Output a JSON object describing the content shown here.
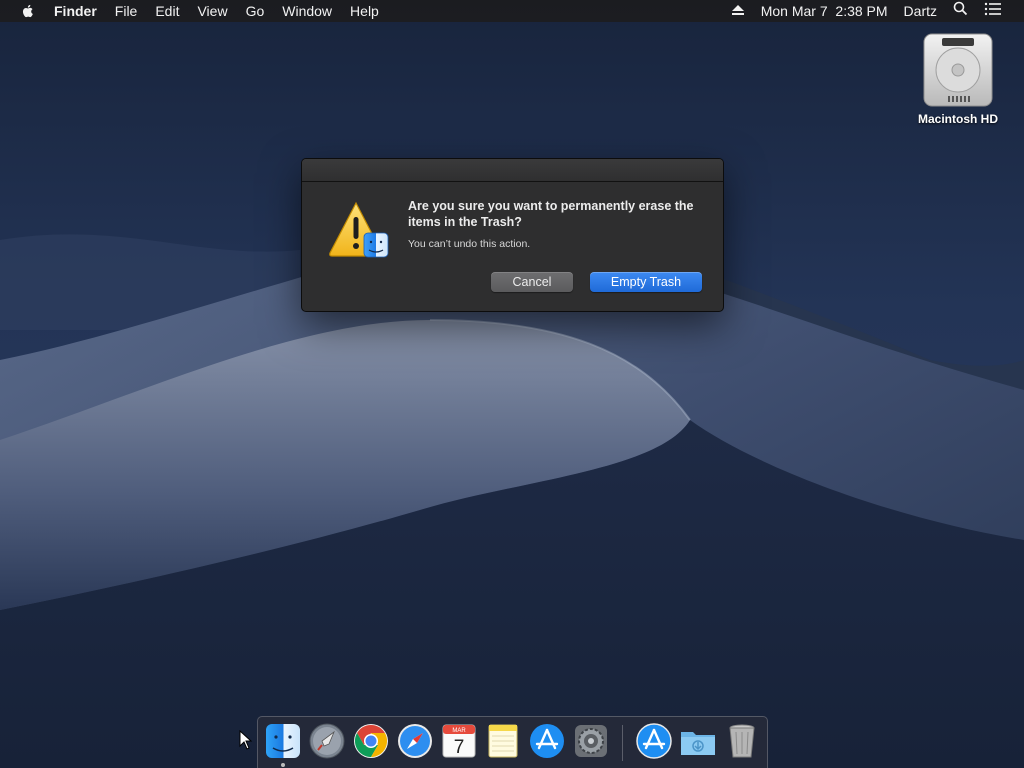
{
  "menubar": {
    "app_name": "Finder",
    "menus": [
      "File",
      "Edit",
      "View",
      "Go",
      "Window",
      "Help"
    ],
    "status": {
      "eject_icon": "eject-icon",
      "datetime": "Mon Mar 7  2:38 PM",
      "user": "Dartz",
      "spotlight_icon": "search-icon",
      "notification_icon": "list-icon"
    }
  },
  "desktop": {
    "icons": [
      {
        "label": "Macintosh HD",
        "icon": "hard-drive-icon"
      }
    ]
  },
  "alert": {
    "title": "Are you sure you want to permanently erase the items in the Trash?",
    "message": "You can’t undo this action.",
    "icon": "warning-finder-icon",
    "cancel_label": "Cancel",
    "confirm_label": "Empty Trash"
  },
  "dock": {
    "apps": [
      {
        "name": "Finder",
        "icon": "finder-icon",
        "running": true
      },
      {
        "name": "Launchpad",
        "icon": "launchpad-icon",
        "running": false
      },
      {
        "name": "Google Chrome",
        "icon": "chrome-icon",
        "running": false
      },
      {
        "name": "Safari",
        "icon": "safari-icon",
        "running": false
      },
      {
        "name": "Calendar",
        "icon": "calendar-icon",
        "running": false
      },
      {
        "name": "Notes",
        "icon": "notes-icon",
        "running": false
      },
      {
        "name": "App Store",
        "icon": "app-store-icon",
        "running": false
      },
      {
        "name": "System Preferences",
        "icon": "system-preferences-icon",
        "running": false
      }
    ],
    "calendar_month": "MAR",
    "calendar_day": "7",
    "others": [
      {
        "name": "Applications",
        "icon": "applications-folder-icon"
      },
      {
        "name": "Downloads",
        "icon": "downloads-folder-icon"
      },
      {
        "name": "Trash",
        "icon": "trash-icon"
      }
    ]
  },
  "colors": {
    "accent_blue": "#1f6ad8",
    "alert_bg": "#2e2e2f",
    "menubar_bg": "#1c1c1e"
  }
}
